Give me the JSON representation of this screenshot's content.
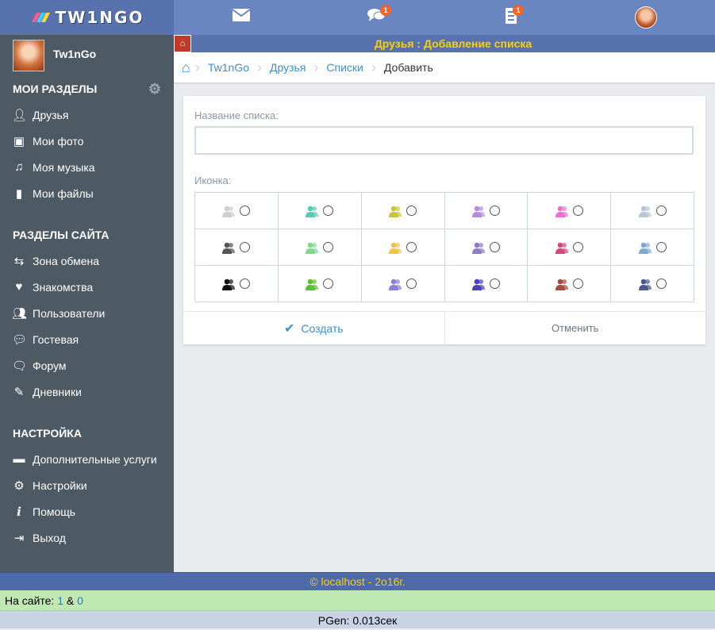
{
  "app": {
    "logo_text": "TW1NGO",
    "brand_color": "#5872ad",
    "accent_color": "#f5d300"
  },
  "topbar": {
    "messages_icon": "envelope-icon",
    "chat_badge": "1",
    "notifications_badge": "1"
  },
  "sidebar": {
    "username": "Tw1nGo",
    "sections": [
      {
        "title": "МОИ РАЗДЕЛЫ",
        "items": [
          {
            "label": "Друзья",
            "icon": "user-icon"
          },
          {
            "label": "Мои фото",
            "icon": "picture-icon"
          },
          {
            "label": "Моя музыка",
            "icon": "music-icon"
          },
          {
            "label": "Мои файлы",
            "icon": "file-icon"
          }
        ]
      },
      {
        "title": "РАЗДЕЛЫ САЙТА",
        "items": [
          {
            "label": "Зона обмена",
            "icon": "exchange-icon"
          },
          {
            "label": "Знакомства",
            "icon": "heart-icon"
          },
          {
            "label": "Пользователи",
            "icon": "users-icon"
          },
          {
            "label": "Гостевая",
            "icon": "comments-icon"
          },
          {
            "label": "Форум",
            "icon": "forum-icon"
          },
          {
            "label": "Дневники",
            "icon": "pencil-icon"
          }
        ]
      },
      {
        "title": "НАСТРОЙКА",
        "items": [
          {
            "label": "Дополнительные услуги",
            "icon": "briefcase-icon"
          },
          {
            "label": "Настройки",
            "icon": "gear-icon"
          },
          {
            "label": "Помощь",
            "icon": "info-icon"
          },
          {
            "label": "Выход",
            "icon": "logout-icon"
          }
        ]
      }
    ]
  },
  "header": {
    "title": "Друзья : Добавление списка"
  },
  "breadcrumb": {
    "items": [
      "Tw1nGo",
      "Друзья",
      "Списки"
    ],
    "current": "Добавить"
  },
  "form": {
    "name_label": "Название списка:",
    "name_value": "",
    "icon_label": "Иконка:",
    "icon_colors": [
      "#cfcfcf",
      "#5cc9b2",
      "#c9c43a",
      "#b48ce0",
      "#ec6fd1",
      "#b8c6d8",
      "#555555",
      "#7bd98a",
      "#f0c24a",
      "#8c7cc9",
      "#d6477a",
      "#7fa8d6",
      "#111111",
      "#5fbf2f",
      "#8b7ed6",
      "#4a3fbf",
      "#a84a3f",
      "#4a5a8f"
    ],
    "create_label": "Создать",
    "cancel_label": "Отменить"
  },
  "footer": {
    "copyright": "© localhost - 2o16г.",
    "online_label": "На сайте:",
    "online_users": "1",
    "online_sep": "&",
    "online_guests": "0",
    "pgen": "PGen: 0.013сек"
  }
}
